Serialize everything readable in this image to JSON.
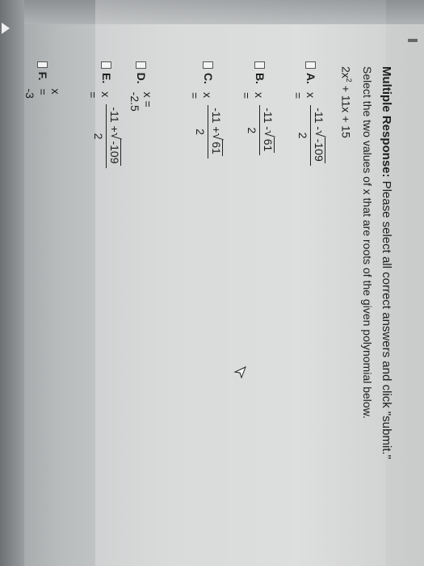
{
  "question": {
    "title_bold": "Multiple Response:",
    "title_rest": " Please select all correct answers and click \"submit.\"",
    "instruction": "Select the two values of x that are roots of the given polynomial below.",
    "polynomial_lead": "2x",
    "polynomial_exp": "2",
    "polynomial_tail": " + 11x + 15"
  },
  "options": [
    {
      "letter": "A.",
      "eq": "x =",
      "num_prefix": "-11 - ",
      "radicand": "-109",
      "den": "2"
    },
    {
      "letter": "B.",
      "eq": "x =",
      "num_prefix": "-11 - ",
      "radicand": "61",
      "den": "2"
    },
    {
      "letter": "C.",
      "eq": "x =",
      "num_prefix": "-11 + ",
      "radicand": "61",
      "den": "2"
    },
    {
      "letter": "D.",
      "eq": "x = -2.5"
    },
    {
      "letter": "E.",
      "eq": "x =",
      "num_prefix": "-11 + ",
      "radicand": "-109",
      "den": "2"
    },
    {
      "letter": "F.",
      "eq": "x = -3"
    }
  ],
  "colors": {
    "text": "#1e1e1e",
    "background": "#d2d4d4"
  },
  "icons": [
    "mouse-cursor-icon",
    "back-arrow-icon"
  ]
}
